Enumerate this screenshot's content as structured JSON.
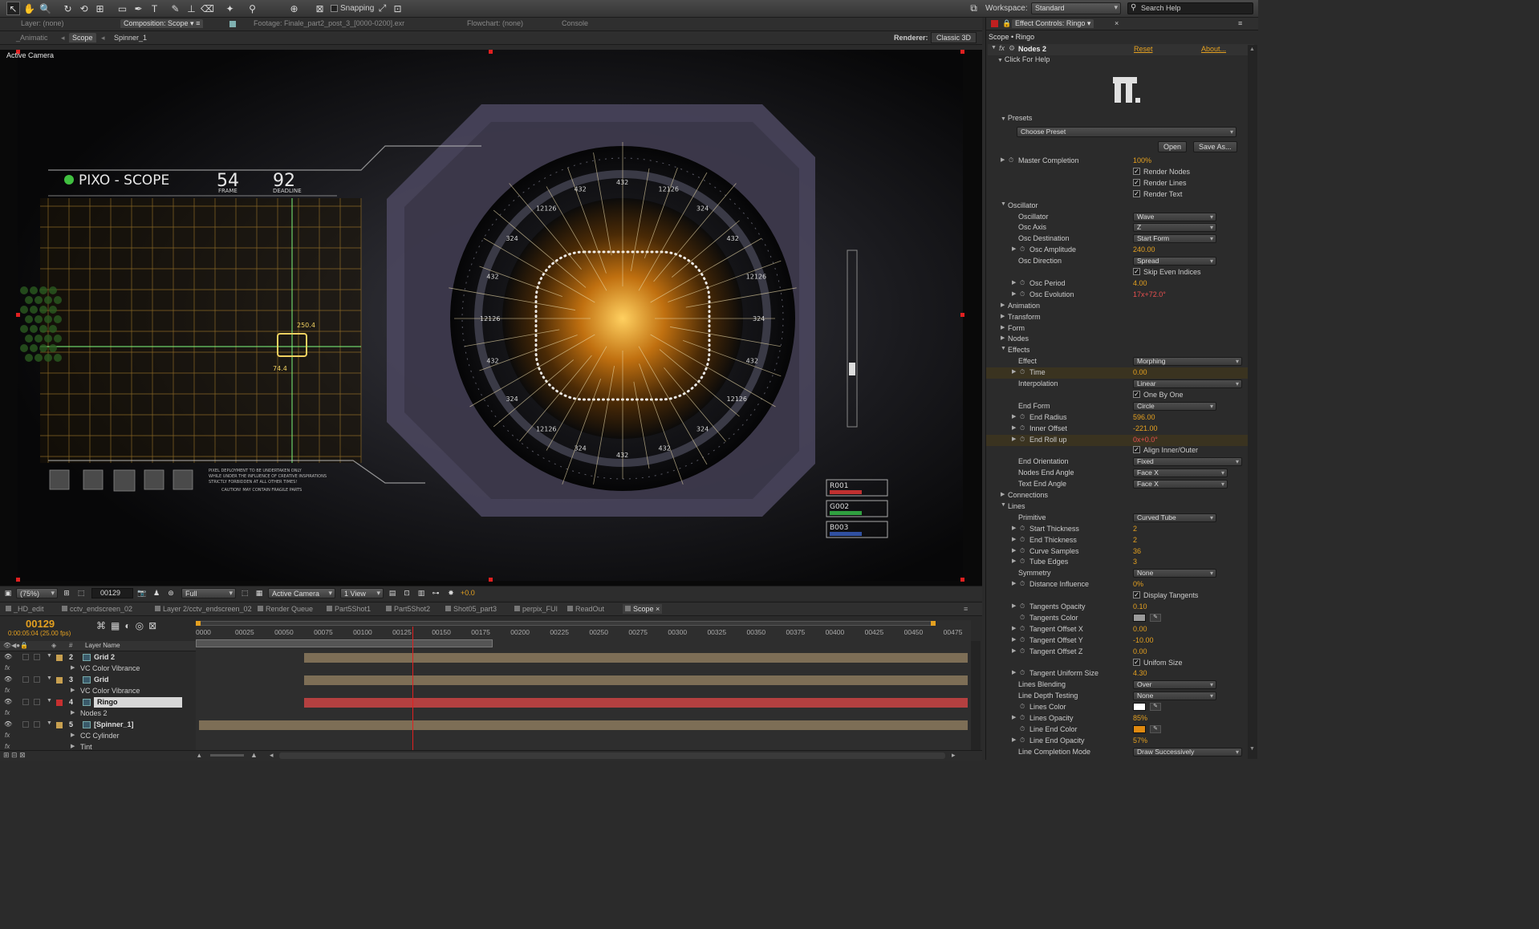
{
  "toolbar": {
    "snapping_label": "Snapping",
    "workspace_label": "Workspace:",
    "workspace_value": "Standard",
    "search_placeholder": "Search Help"
  },
  "viewer_tabs": {
    "layer": "Layer: (none)",
    "composition": "Composition: Scope",
    "footage": "Footage: Finale_part2_post_3_[0000-0200].exr",
    "flowchart": "Flowchart: (none)",
    "console": "Console"
  },
  "breadcrumb": {
    "items": [
      "_Animatic",
      "Scope",
      "Spinner_1"
    ],
    "renderer_label": "Renderer:",
    "renderer_value": "Classic 3D"
  },
  "viewer": {
    "camera_label": "Active Camera",
    "hud": {
      "logo_text": "PIXO - SCOPE",
      "frame_value": "54",
      "frame_label": "FRAME",
      "deadline_value": "92",
      "deadline_label": "DEADLINE",
      "grid_value_1": "250.4",
      "grid_value_2": "74.4",
      "warning_line_1": "PIXEL DEPLOYMENT TO BE UNDERTAKEN ONLY",
      "warning_line_2": "WHILE UNDER THE INFLUENCE OF CREATIVE INSPIRATIONS",
      "warning_line_3": "STRICTLY FORBIDDEN AT ALL OTHER TIMES!",
      "caution": "CAUTION! MAY CONTAIN FRAGILE PARTS",
      "ring_numbers": [
        "432",
        "12126",
        "324",
        "432",
        "12126",
        "324",
        "432",
        "12126",
        "324",
        "432",
        "432",
        "324",
        "12126",
        "324",
        "432",
        "12126",
        "432",
        "324",
        "12126",
        "432"
      ],
      "status_codes": [
        "R001",
        "G002",
        "B003"
      ]
    }
  },
  "viewer_bar": {
    "zoom": "(75%)",
    "timecode": "00129",
    "resolution": "Full",
    "camera": "Active Camera",
    "views": "1 View",
    "exposure": "+0.0"
  },
  "effect_controls": {
    "tab_label": "Effect Controls: Ringo",
    "path": "Scope • Ringo",
    "effect_name": "Nodes 2",
    "reset": "Reset",
    "about": "About...",
    "help": "Click For Help",
    "presets_label": "Presets",
    "preset_value": "Choose Preset",
    "open_button": "Open",
    "save_button": "Save As...",
    "rows": [
      {
        "type": "value",
        "indent": 2,
        "stopwatch": true,
        "tri": true,
        "label": "Master Completion",
        "value": "100%"
      },
      {
        "type": "check",
        "indent": 0,
        "label": "",
        "check_label": "Render Nodes",
        "checked": true
      },
      {
        "type": "check",
        "indent": 0,
        "label": "",
        "check_label": "Render Lines",
        "checked": true
      },
      {
        "type": "check",
        "indent": 0,
        "label": "",
        "check_label": "Render Text",
        "checked": true
      },
      {
        "type": "group",
        "indent": 1,
        "open": true,
        "label": "Oscillator"
      },
      {
        "type": "dropdown",
        "indent": 3,
        "label": "Oscillator",
        "value": "Wave"
      },
      {
        "type": "dropdown",
        "indent": 3,
        "label": "Osc Axis",
        "value": "Z"
      },
      {
        "type": "dropdown",
        "indent": 3,
        "label": "Osc Destination",
        "value": "Start Form"
      },
      {
        "type": "value",
        "indent": 3,
        "stopwatch": true,
        "tri": true,
        "label": "Osc Amplitude",
        "value": "240.00"
      },
      {
        "type": "dropdown",
        "indent": 3,
        "label": "Osc Direction",
        "value": "Spread"
      },
      {
        "type": "check",
        "indent": 0,
        "label": "",
        "check_label": "Skip Even Indices",
        "checked": true
      },
      {
        "type": "value",
        "indent": 3,
        "stopwatch": true,
        "tri": true,
        "label": "Osc Period",
        "value": "4.00"
      },
      {
        "type": "value",
        "indent": 3,
        "stopwatch": true,
        "tri": true,
        "label": "Osc Evolution",
        "value": "17x+72.0°",
        "red": true
      },
      {
        "type": "group",
        "indent": 1,
        "open": false,
        "label": "Animation"
      },
      {
        "type": "group",
        "indent": 1,
        "open": false,
        "label": "Transform"
      },
      {
        "type": "group",
        "indent": 1,
        "open": false,
        "label": "Form"
      },
      {
        "type": "group",
        "indent": 1,
        "open": false,
        "label": "Nodes"
      },
      {
        "type": "group",
        "indent": 1,
        "open": true,
        "label": "Effects"
      },
      {
        "type": "dropdown",
        "indent": 3,
        "label": "Effect",
        "value": "Morphing",
        "wide": true
      },
      {
        "type": "value",
        "indent": 3,
        "stopwatch": true,
        "tri": true,
        "label": "Time",
        "value": "0.00",
        "hl": true
      },
      {
        "type": "dropdown",
        "indent": 3,
        "label": "Interpolation",
        "value": "Linear",
        "wide": true
      },
      {
        "type": "check",
        "indent": 0,
        "label": "",
        "check_label": "One By One",
        "checked": true
      },
      {
        "type": "dropdown",
        "indent": 3,
        "label": "End Form",
        "value": "Circle"
      },
      {
        "type": "value",
        "indent": 3,
        "stopwatch": true,
        "tri": true,
        "label": "End Radius",
        "value": "596.00"
      },
      {
        "type": "value",
        "indent": 3,
        "stopwatch": true,
        "tri": true,
        "label": "Inner Offset",
        "value": "-221.00"
      },
      {
        "type": "value",
        "indent": 3,
        "stopwatch": true,
        "tri": true,
        "label": "End Roll up",
        "value": "0x+0.0°",
        "red": true,
        "hl": true
      },
      {
        "type": "check",
        "indent": 0,
        "label": "",
        "check_label": "Align Inner/Outer",
        "checked": true
      },
      {
        "type": "dropdown",
        "indent": 3,
        "label": "End Orientation",
        "value": "Fixed",
        "wide": true
      },
      {
        "type": "dropdown",
        "indent": 3,
        "label": "Nodes End Angle",
        "value": "Face  X",
        "medium": true
      },
      {
        "type": "dropdown",
        "indent": 3,
        "label": "Text End Angle",
        "value": "Face  X",
        "medium": true
      },
      {
        "type": "group",
        "indent": 1,
        "open": false,
        "label": "Connections"
      },
      {
        "type": "group",
        "indent": 1,
        "open": true,
        "label": "Lines"
      },
      {
        "type": "dropdown",
        "indent": 3,
        "label": "Primitive",
        "value": "Curved Tube"
      },
      {
        "type": "value",
        "indent": 3,
        "stopwatch": true,
        "tri": true,
        "label": "Start Thickness",
        "value": "2"
      },
      {
        "type": "value",
        "indent": 3,
        "stopwatch": true,
        "tri": true,
        "label": "End Thickness",
        "value": "2"
      },
      {
        "type": "value",
        "indent": 3,
        "stopwatch": true,
        "tri": true,
        "label": "Curve Samples",
        "value": "36"
      },
      {
        "type": "value",
        "indent": 3,
        "stopwatch": true,
        "tri": true,
        "label": "Tube Edges",
        "value": "3"
      },
      {
        "type": "dropdown",
        "indent": 3,
        "label": "Symmetry",
        "value": "None"
      },
      {
        "type": "value",
        "indent": 3,
        "stopwatch": true,
        "tri": true,
        "label": "Distance Influence",
        "value": "0%"
      },
      {
        "type": "check",
        "indent": 0,
        "label": "",
        "check_label": "Display Tangents",
        "checked": true
      },
      {
        "type": "value",
        "indent": 3,
        "stopwatch": true,
        "tri": true,
        "label": "Tangents Opacity",
        "value": "0.10"
      },
      {
        "type": "color",
        "indent": 3,
        "stopwatch": true,
        "tri": false,
        "label": "Tangents Color",
        "color": "#9a9a9a"
      },
      {
        "type": "value",
        "indent": 3,
        "stopwatch": true,
        "tri": true,
        "label": "Tangent Offset X",
        "value": "0.00"
      },
      {
        "type": "value",
        "indent": 3,
        "stopwatch": true,
        "tri": true,
        "label": "Tangent Offset Y",
        "value": "-10.00"
      },
      {
        "type": "value",
        "indent": 3,
        "stopwatch": true,
        "tri": true,
        "label": "Tangent Offset Z",
        "value": "0.00"
      },
      {
        "type": "check",
        "indent": 0,
        "label": "",
        "check_label": "Unifom Size",
        "checked": true
      },
      {
        "type": "value",
        "indent": 3,
        "stopwatch": true,
        "tri": true,
        "label": "Tangent Uniform Size",
        "value": "4.30"
      },
      {
        "type": "dropdown",
        "indent": 3,
        "label": "Lines Blending",
        "value": "Over"
      },
      {
        "type": "dropdown",
        "indent": 3,
        "label": "Line Depth Testing",
        "value": "None"
      },
      {
        "type": "color",
        "indent": 3,
        "stopwatch": true,
        "tri": false,
        "label": "Lines Color",
        "color": "#ffffff"
      },
      {
        "type": "value",
        "indent": 3,
        "stopwatch": true,
        "tri": true,
        "label": "Lines Opacity",
        "value": "85%"
      },
      {
        "type": "color",
        "indent": 3,
        "stopwatch": true,
        "tri": false,
        "label": "Line End Color",
        "color": "#e08a10"
      },
      {
        "type": "value",
        "indent": 3,
        "stopwatch": true,
        "tri": true,
        "label": "Line End Opacity",
        "value": "57%"
      },
      {
        "type": "dropdown",
        "indent": 3,
        "label": "Line Completion Mode",
        "value": "Draw Successively",
        "wide": true
      }
    ]
  },
  "timeline": {
    "tabs": [
      "_HD_edit",
      "cctv_endscreen_02",
      "Layer 2/cctv_endscreen_02",
      "Render Queue",
      "Part5Shot1",
      "Part5Shot2",
      "Shot05_part3",
      "perpix_FUI",
      "ReadOut",
      "Scope"
    ],
    "current_frame": "00129",
    "timecode_detail": "0:00:05:04 (25.00 fps)",
    "column_hash": "#",
    "column_layer_name": "Layer Name",
    "ticks": [
      "0000",
      "00025",
      "00050",
      "00075",
      "00100",
      "00125",
      "00150",
      "00175",
      "00200",
      "00225",
      "00250",
      "00275",
      "00300",
      "00325",
      "00350",
      "00375",
      "00400",
      "00425",
      "00450",
      "00475"
    ],
    "work_area_end": 0.795,
    "playhead": 0.279,
    "layers": [
      {
        "kind": "layer",
        "num": "2",
        "name": "Grid 2",
        "color": "#c8a050"
      },
      {
        "kind": "fx",
        "name": "VC Color Vibrance"
      },
      {
        "kind": "layer",
        "num": "3",
        "name": "Grid",
        "color": "#c8a050"
      },
      {
        "kind": "fx",
        "name": "VC Color Vibrance"
      },
      {
        "kind": "layer",
        "num": "4",
        "name": "Ringo",
        "color": "#c83030",
        "selected": true
      },
      {
        "kind": "fx",
        "name": "Nodes 2"
      },
      {
        "kind": "layer",
        "num": "5",
        "name": "[Spinner_1]",
        "color": "#c8a050"
      },
      {
        "kind": "fx",
        "name": "CC Cylinder"
      },
      {
        "kind": "fx",
        "name": "Tint"
      }
    ]
  }
}
